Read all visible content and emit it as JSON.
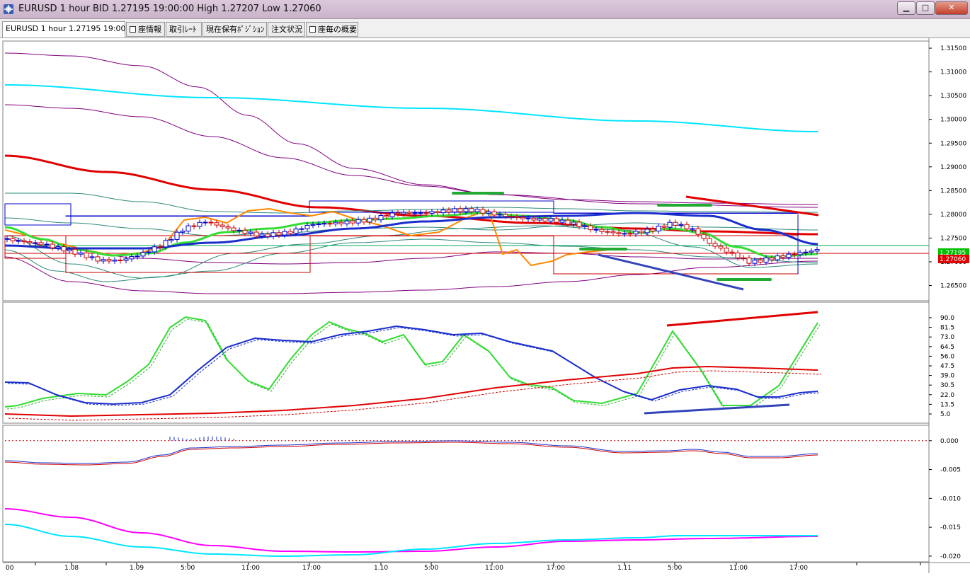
{
  "window": {
    "title": "EURUSD 1 hour BID 1.27195 19:00:00 High 1.27207 Low 1.27060",
    "buttons": {
      "minimize": "▁",
      "maximize": "□",
      "close": "✕"
    }
  },
  "tabs": [
    {
      "label": "EURUSD 1 hour 1.27195 19:00:00",
      "active": true,
      "square": false
    },
    {
      "label": "座情報",
      "active": false,
      "square": true
    },
    {
      "label": "取引ﾚｰﾄ",
      "active": false,
      "square": false
    },
    {
      "label": "現在保有ﾎﾟｼﾞｼｮﾝ",
      "active": false,
      "square": false
    },
    {
      "label": "注文状況",
      "active": false,
      "square": false
    },
    {
      "label": "座毎の概要",
      "active": false,
      "square": true
    }
  ],
  "chart_data": [
    {
      "type": "candlestick",
      "panel": "price",
      "y_ticks": [
        "1.31500",
        "1.31000",
        "1.30500",
        "1.30000",
        "1.29500",
        "1.29000",
        "1.28500",
        "1.28000",
        "1.27500",
        "1.27000",
        "1.26500"
      ],
      "ylim": [
        1.2618,
        1.3165
      ],
      "price_labels": [
        {
          "value": "1.27195",
          "price": 1.27195,
          "bg": "#00c000"
        },
        {
          "value": "1.27060",
          "price": 1.2706,
          "bg": "#e00000"
        }
      ],
      "colors": {
        "bull": "#0000cc",
        "bear": "#cc0000"
      }
    },
    {
      "type": "line",
      "panel": "oscillator",
      "y_ticks": [
        "90.0",
        "81.5",
        "73.0",
        "64.5",
        "56.0",
        "47.5",
        "39.0",
        "30.5",
        "22.0",
        "13.5",
        "5.0"
      ],
      "ylim": [
        0,
        100
      ]
    },
    {
      "type": "line",
      "panel": "macd",
      "y_ticks": [
        "0.000",
        "-0.005",
        "-0.010",
        "-0.015",
        "-0.020"
      ],
      "ylim": [
        -0.0205,
        0.0012
      ]
    }
  ],
  "x_axis": {
    "labels": [
      "1.08",
      "1.09",
      "5:00",
      "11:00",
      "17:00",
      "1.10",
      "5:00",
      "11:00",
      "17:00",
      "1.11",
      "5:00",
      "11:00",
      "17:00"
    ],
    "left_partial": "00"
  }
}
